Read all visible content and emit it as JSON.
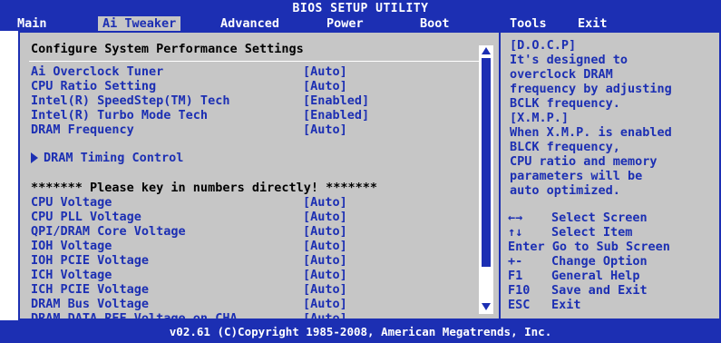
{
  "app": {
    "title": "BIOS SETUP UTILITY"
  },
  "menu": [
    {
      "label": "Main"
    },
    {
      "label": "Ai Tweaker",
      "active": true
    },
    {
      "label": "Advanced"
    },
    {
      "label": "Power"
    },
    {
      "label": "Boot"
    },
    {
      "label": "Tools"
    },
    {
      "label": "Exit"
    }
  ],
  "left": {
    "heading": "Configure System Performance Settings",
    "rows": [
      {
        "label": "Ai Overclock Tuner",
        "value": "[Auto]"
      },
      {
        "label": "CPU Ratio Setting",
        "value": "[Auto]"
      },
      {
        "label": "Intel(R) SpeedStep(TM) Tech",
        "value": "[Enabled]"
      },
      {
        "label": "Intel(R) Turbo Mode Tech",
        "value": "[Enabled]"
      },
      {
        "label": "DRAM Frequency",
        "value": "[Auto]"
      }
    ],
    "submenu": "DRAM Timing Control",
    "notice": "******* Please key in numbers directly! *******",
    "voltages": [
      {
        "label": "CPU Voltage",
        "value": "[Auto]"
      },
      {
        "label": "CPU PLL Voltage",
        "value": "[Auto]"
      },
      {
        "label": "QPI/DRAM Core Voltage",
        "value": "[Auto]"
      },
      {
        "label": "IOH Voltage",
        "value": "[Auto]"
      },
      {
        "label": "IOH PCIE Voltage",
        "value": "[Auto]"
      },
      {
        "label": "ICH Voltage",
        "value": "[Auto]"
      },
      {
        "label": "ICH PCIE Voltage",
        "value": "[Auto]"
      },
      {
        "label": "DRAM Bus Voltage",
        "value": "[Auto]"
      },
      {
        "label": "DRAM DATA REF Voltage on CHA",
        "value": "[Auto]"
      }
    ]
  },
  "right": {
    "help_lines": [
      "[D.O.C.P]",
      "It's designed to",
      "overclock DRAM",
      "frequency by adjusting",
      "BCLK frequency.",
      "[X.M.P.]",
      "When X.M.P. is enabled",
      "BLCK frequency,",
      "CPU ratio and memory",
      "parameters will be",
      "auto optimized."
    ],
    "keys": [
      {
        "key": "←→",
        "desc": "Select Screen"
      },
      {
        "key": "↑↓",
        "desc": "Select Item"
      },
      {
        "key": "Enter",
        "desc": "Go to Sub Screen"
      },
      {
        "key": "+-",
        "desc": "Change Option"
      },
      {
        "key": "F1",
        "desc": "General Help"
      },
      {
        "key": "F10",
        "desc": "Save and Exit"
      },
      {
        "key": "ESC",
        "desc": "Exit"
      }
    ]
  },
  "footer": {
    "text": "v02.61 (C)Copyright 1985-2008, American Megatrends, Inc."
  },
  "colors": {
    "blue": "#1c2fb3",
    "panel": "#c6c6c6",
    "white": "#ffffff"
  }
}
